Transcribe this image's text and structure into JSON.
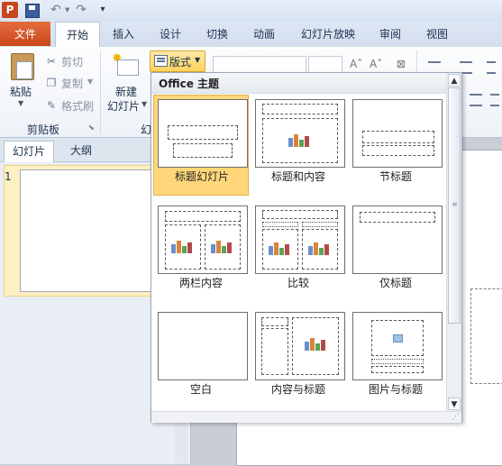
{
  "app": {
    "logo_text": "P"
  },
  "tabs": [
    "文件",
    "开始",
    "插入",
    "设计",
    "切换",
    "动画",
    "幻灯片放映",
    "审阅",
    "视图"
  ],
  "ribbon": {
    "paste_label": "粘贴",
    "cut_label": "剪切",
    "copy_label": "复制",
    "format_painter_label": "格式刷",
    "clipboard_group": "剪贴板",
    "new_slide_label_1": "新建",
    "new_slide_label_2": "幻灯片",
    "slides_group_partial": "幻",
    "layout_button_label": "版式"
  },
  "side_panel": {
    "tabs": [
      "幻灯片",
      "大纲"
    ],
    "slide_number": "1"
  },
  "layout_gallery": {
    "header": "Office 主题",
    "selected": "标题幻灯片",
    "items": [
      "标题幻灯片",
      "标题和内容",
      "节标题",
      "两栏内容",
      "比较",
      "仅标题",
      "空白",
      "内容与标题",
      "图片与标题"
    ]
  },
  "colors": {
    "file_tab": "#c9461b",
    "selection": "#ffd77a",
    "ribbon_bg": "#fdfdfe"
  }
}
